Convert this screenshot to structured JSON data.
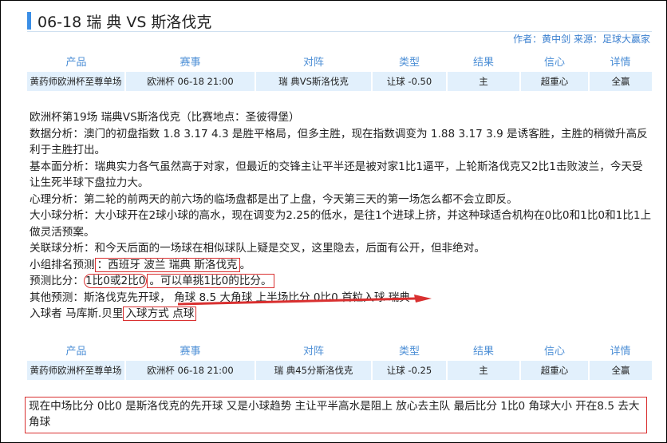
{
  "header": {
    "title": "06-18 瑞 典 VS 斯洛伐克",
    "byline": "作者：黄中剑 来源：足球大赢家"
  },
  "columns": [
    "产品",
    "赛事",
    "对阵",
    "类型",
    "结果",
    "信心",
    "详情"
  ],
  "pick1": {
    "row": [
      "黄药师欧洲杯至尊单场",
      "欧洲杯 06-18 21:00",
      "瑞 典VS斯洛伐克",
      "让球 -0.50",
      "主",
      "超重心",
      "全赢"
    ]
  },
  "pick2": {
    "row": [
      "黄药师欧洲杯至尊单场",
      "欧洲杯 06-18 21:00",
      "瑞 典45分斯洛伐克",
      "让球 -0.25",
      "主",
      "超重心",
      "全赢"
    ]
  },
  "analysis": {
    "match_line": "欧洲杯第19场 瑞典VS斯洛伐克（比赛地点：圣彼得堡）",
    "data_analysis": "数据分析：澳门的初盘指数 1.8 3.17 4.3 是胜平格局，但多主胜，现在指数调变为 1.88 3.17 3.9 是诱客胜，主胜的稍微升高反利于主胜打出。",
    "fundamentals": "基本面分析：瑞典实力各气虽然高于对家，但最近的交锋主让平半还是被对家1比1逼平，上轮斯洛伐克又2比1击败波兰，今天受让生死半球下盘拉力大。",
    "psychology": "心理分析：第二轮的前两天的前六场的临场盘都是出了上盘，今天第三天的第一场怎么都不会立即反。",
    "over_under": "大小球分析：大小球开在2球小球的高水，现在调变为2.25的低水，是往1个进球上挤，并这种球适合机构在0比0和1比0和1比1上做灵活预案。",
    "related": "关联球分析：和今天后面的一场球在相似球队上疑是交叉，这里隐去，后面有公开，但非绝对。",
    "group_label": "小组排名预测",
    "group_value": "：西班牙 波兰 瑞典 斯洛伐克",
    "group_end": "。",
    "score_label": "预测比分：",
    "score_a": "1比0或2比0",
    "score_b": "。可以单挑1比0的比分。",
    "other": "其他预测：斯洛伐克先开球， 角球 8.5 大角球 上半场比分 0比0 首粒入球 瑞典",
    "scorer_label": "入球者 马库斯.贝里",
    "scorer_box": "入球方式 点球"
  },
  "bottom_note": "现在中场比分 0比0  是斯洛伐克的先开球  又是小球趋势  主让平半高水是阻上  放心去主队  最后比分  1比0  角球大小 开在8.5  去大角球",
  "colors": {
    "accent": "#3a8ee6",
    "header_text": "#4d8fd6",
    "row_bg": "#e2f0fc",
    "annotation": "#d93030"
  }
}
